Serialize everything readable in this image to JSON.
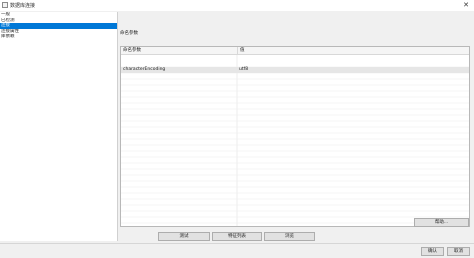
{
  "window": {
    "title": "数据库连接"
  },
  "sidebar": {
    "items": [
      {
        "label": "一般",
        "selected": false
      },
      {
        "label": "已检测",
        "selected": false
      },
      {
        "label": "连接",
        "selected": true
      },
      {
        "label": "连接属性",
        "selected": false
      },
      {
        "label": "库依赖",
        "selected": false
      }
    ]
  },
  "main": {
    "section_label": "命名参数",
    "grid": {
      "columns": [
        "命名参数",
        "值"
      ],
      "rows": [
        [
          "characterEncoding",
          "utf8"
        ]
      ]
    },
    "help_button": "帮助..."
  },
  "footer": {
    "test_button": "测试",
    "feature_list_button": "特征列表",
    "explore_button": "浏览",
    "ok_button": "确认",
    "cancel_button": "取消"
  }
}
